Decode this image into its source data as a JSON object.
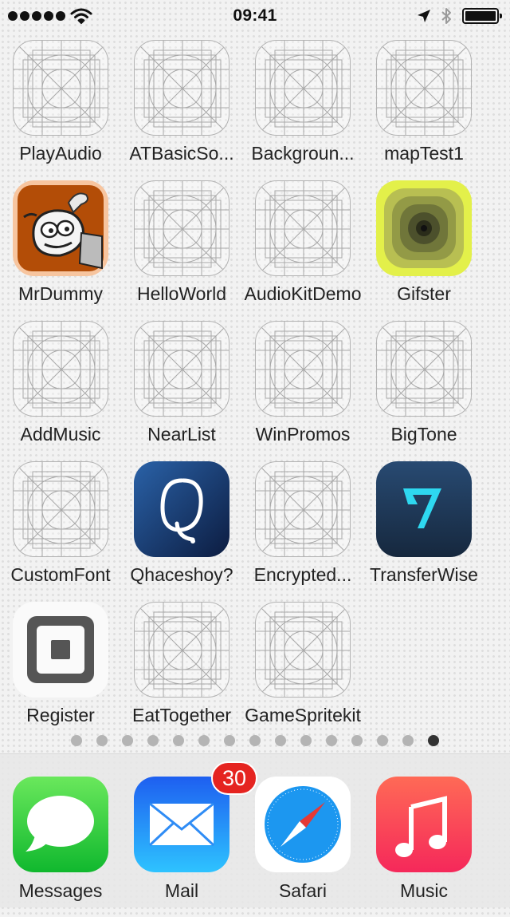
{
  "status_bar": {
    "time": "09:41",
    "signal_icon": "signal-dots-icon",
    "wifi_icon": "wifi-icon",
    "location_icon": "location-arrow-icon",
    "bluetooth_icon": "bluetooth-icon",
    "battery_icon": "battery-icon",
    "battery_level": 1.0
  },
  "apps": [
    {
      "label": "PlayAudio",
      "icon": "placeholder-icon"
    },
    {
      "label": "ATBasicSo...",
      "icon": "placeholder-icon"
    },
    {
      "label": "Backgroun...",
      "icon": "placeholder-icon"
    },
    {
      "label": "mapTest1",
      "icon": "placeholder-icon"
    },
    {
      "label": "MrDummy",
      "icon": "cartoon-character-icon"
    },
    {
      "label": "HelloWorld",
      "icon": "placeholder-icon"
    },
    {
      "label": "AudioKitDemo",
      "icon": "placeholder-icon"
    },
    {
      "label": "Gifster",
      "icon": "concentric-squares-icon"
    },
    {
      "label": "AddMusic",
      "icon": "placeholder-icon"
    },
    {
      "label": "NearList",
      "icon": "placeholder-icon"
    },
    {
      "label": "WinPromos",
      "icon": "placeholder-icon"
    },
    {
      "label": "BigTone",
      "icon": "placeholder-icon"
    },
    {
      "label": "CustomFont",
      "icon": "placeholder-icon"
    },
    {
      "label": "Qhaceshoy?",
      "icon": "q-letter-icon"
    },
    {
      "label": "Encrypted...",
      "icon": "placeholder-icon"
    },
    {
      "label": "TransferWise",
      "icon": "transferwise-logo-icon"
    },
    {
      "label": "Register",
      "icon": "square-register-icon"
    },
    {
      "label": "EatTogether",
      "icon": "placeholder-icon"
    },
    {
      "label": "GameSpritekit",
      "icon": "placeholder-icon"
    }
  ],
  "page_indicator": {
    "count": 15,
    "active_index": 14
  },
  "dock": {
    "apps": [
      {
        "label": "Messages",
        "icon": "speech-bubble-icon"
      },
      {
        "label": "Mail",
        "icon": "envelope-icon",
        "badge": "30"
      },
      {
        "label": "Safari",
        "icon": "compass-icon"
      },
      {
        "label": "Music",
        "icon": "music-note-icon"
      }
    ]
  },
  "colors": {
    "badge": "#e52420",
    "messages": "#3dd04a",
    "mail": "#1e7df0",
    "safari": "#1a96f0",
    "music": "#f5424f",
    "transferwise": "#1d3a5f",
    "transferwise_accent": "#2ed8f0",
    "qhaceshoy": "#1b3f7a",
    "gifster": "#e3f04a",
    "mrdummy": "#b34d07"
  }
}
